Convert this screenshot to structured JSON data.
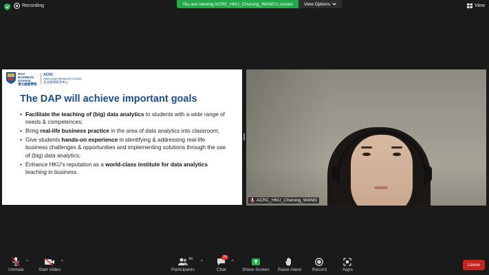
{
  "topbar": {
    "recording_label": "Recording",
    "banner_text": "You are viewing ACRC_HKU_Churong_WANG's screen",
    "view_options_label": "View Options",
    "view_label": "View"
  },
  "slide": {
    "logo_school": "HKU BUSINESS SCHOOL",
    "logo_school_cn": "港大經管學院",
    "logo_acrc": "ACRC",
    "logo_acrc_sub": "Asia Case Research Centre",
    "logo_acrc_cn": "亞洲案例研究中心",
    "title": "The DAP will achieve important goals",
    "bullets": [
      {
        "bold": "Facilitate the teaching of (big) data analytics",
        "rest": " to students with a wide range of needs & competences;"
      },
      {
        "pre": "Bring ",
        "bold": "real-life business practice",
        "rest": " in the area of data analytics into classroom;"
      },
      {
        "pre": "Give students ",
        "bold": "hands-on experience",
        "rest": " in identifying & addressing real-life business challenges & opportunities and implementing solutions through the use of (big) data analytics;"
      },
      {
        "pre": "Enhance HKU's reputation as a ",
        "bold": "world-class institute for data analytics",
        "rest": " teaching in business."
      }
    ]
  },
  "video": {
    "name": "ACRC_HKU_Churong_WANG"
  },
  "toolbar": {
    "unmute": "Unmute",
    "start_video": "Start Video",
    "participants": "Participants",
    "participants_count": "40",
    "chat": "Chat",
    "chat_badge": "24",
    "share_screen": "Share Screen",
    "raise_hand": "Raise Hand",
    "record": "Record",
    "apps": "Apps",
    "leave": "Leave"
  },
  "colors": {
    "banner_green": "#22a948",
    "leave_red": "#c8241f",
    "slide_title_blue": "#1c4c8c",
    "share_green": "#23b14d"
  }
}
